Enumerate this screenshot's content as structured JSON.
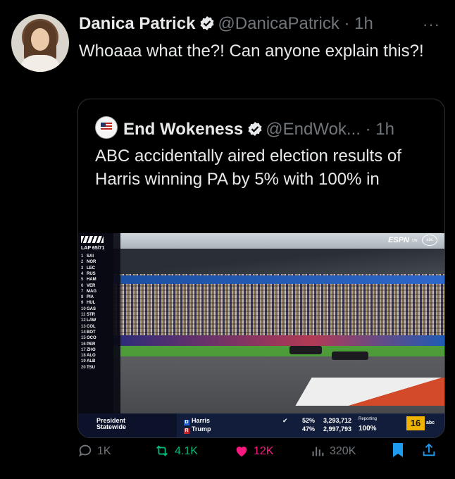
{
  "tweet": {
    "author_name": "Danica Patrick",
    "handle": "@DanicaPatrick",
    "time": "· 1h",
    "more": "···",
    "text": "Whoaaa what the?! Can anyone explain this?!"
  },
  "quote": {
    "author_name": "End Wokeness",
    "handle": "@EndWok...",
    "time": "· 1h",
    "text": "ABC accidentally aired election results of Harris winning PA by 5% with 100% in"
  },
  "broadcast": {
    "lap": "LAP 65/71",
    "leaderboard": [
      {
        "pos": "1",
        "code": "SAI"
      },
      {
        "pos": "2",
        "code": "NOR"
      },
      {
        "pos": "3",
        "code": "LEC"
      },
      {
        "pos": "4",
        "code": "RUS"
      },
      {
        "pos": "5",
        "code": "HAM"
      },
      {
        "pos": "6",
        "code": "VER"
      },
      {
        "pos": "7",
        "code": "MAG"
      },
      {
        "pos": "8",
        "code": "PIA"
      },
      {
        "pos": "9",
        "code": "HUL"
      },
      {
        "pos": "10",
        "code": "GAS"
      },
      {
        "pos": "11",
        "code": "STR"
      },
      {
        "pos": "12",
        "code": "LAW"
      },
      {
        "pos": "13",
        "code": "COL"
      },
      {
        "pos": "14",
        "code": "BOT"
      },
      {
        "pos": "15",
        "code": "OCO"
      },
      {
        "pos": "16",
        "code": "PER"
      },
      {
        "pos": "17",
        "code": "ZHO"
      },
      {
        "pos": "18",
        "code": "ALO"
      },
      {
        "pos": "19",
        "code": "ALB"
      },
      {
        "pos": "20",
        "code": "TSU"
      }
    ],
    "network": "ESPN",
    "on_label": "ON",
    "abc_label": "abc",
    "ticker": {
      "race_line1": "President",
      "race_line2": "Statewide",
      "candidates": [
        {
          "party": "D",
          "name": "Harris",
          "pct": "52%",
          "votes": "3,293,712",
          "color": "#1f5fd1",
          "check": "✔"
        },
        {
          "party": "R",
          "name": "Trump",
          "pct": "47%",
          "votes": "2,997,793",
          "color": "#c8232c",
          "check": ""
        }
      ],
      "reporting_label": "Reporting",
      "reporting_value": "100%",
      "channel_number": "16",
      "channel_network": "abc"
    }
  },
  "actions": {
    "replies": "1K",
    "reposts": "4.1K",
    "likes": "12K",
    "views": "320K"
  },
  "colors": {
    "background": "#000000",
    "text": "#e7e9ea",
    "muted": "#71767b",
    "verified": "#1d9bf0",
    "repost_green": "#00ba7c",
    "like_pink": "#f91880",
    "bookmark_blue": "#1d9bf0"
  }
}
